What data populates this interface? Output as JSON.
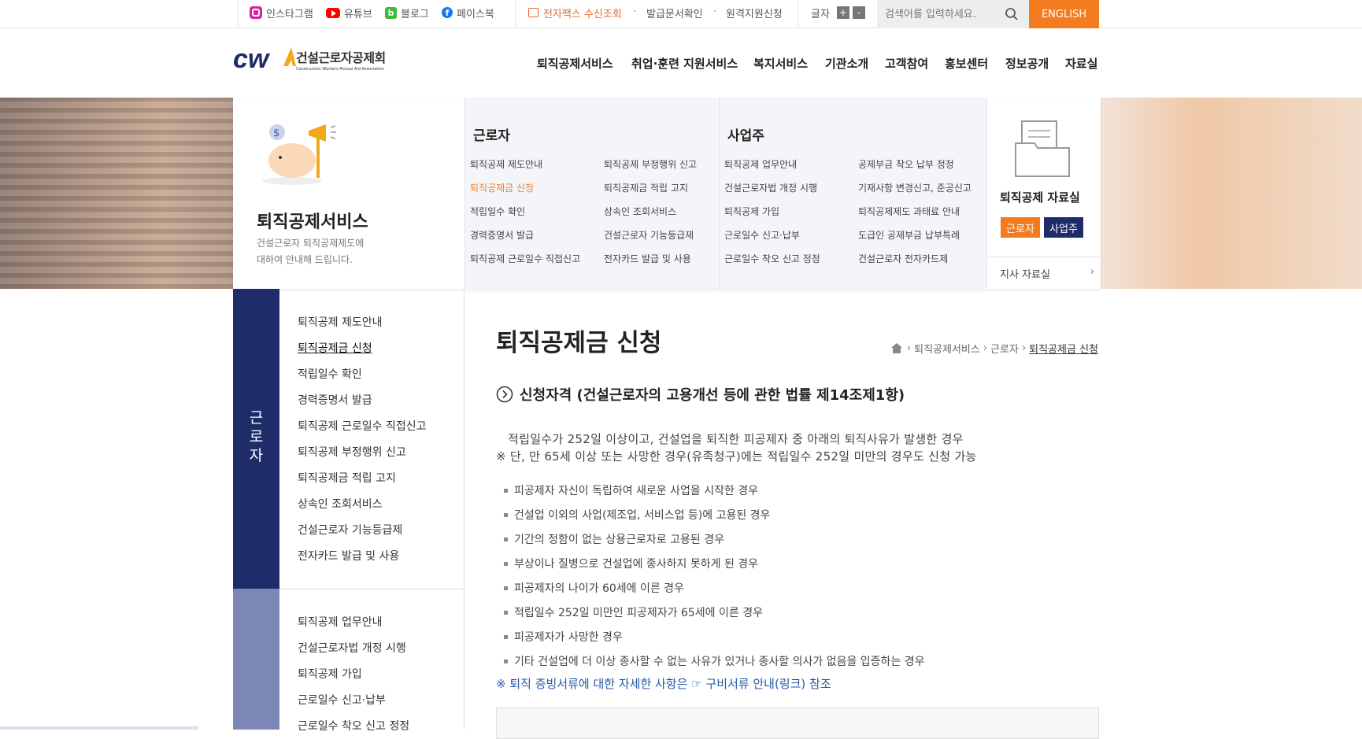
{
  "topbar": {
    "sns": [
      {
        "label": "인스타그램",
        "icon": "instagram-icon",
        "color": "#d6249f"
      },
      {
        "label": "유튜브",
        "icon": "youtube-icon",
        "color": "#ff0000"
      },
      {
        "label": "블로그",
        "icon": "blog-icon",
        "color": "#3dbb36"
      },
      {
        "label": "페이스북",
        "icon": "facebook-icon",
        "color": "#1877f2"
      }
    ],
    "fax_link": "전자팩스 수신조회",
    "doc_link": "발급문서확인",
    "remote_link": "원격지원신청",
    "font_size_label": "글자",
    "font_plus": "+",
    "font_minus": "-",
    "search_placeholder": "검색어를 입력하세요.",
    "english": "ENGLISH"
  },
  "header": {
    "logo_mark": "cw",
    "logo_kr": "건설근로자공제회",
    "logo_en": "Construction Workers Mutual Aid Association",
    "gnb": [
      "퇴직공제서비스",
      "취업·훈련 지원서비스",
      "복지서비스",
      "기관소개",
      "고객참여",
      "홍보센터",
      "정보공개",
      "자료실"
    ]
  },
  "mega": {
    "intro_title": "퇴직공제서비스",
    "intro_desc_1": "건설근로자 퇴직공제제도에",
    "intro_desc_2": "대하여 안내해 드립니다.",
    "worker_title": "근로자",
    "worker_col1": [
      "퇴직공제 제도안내",
      "퇴직공제금 신청",
      "적립일수 확인",
      "경력증명서 발급",
      "퇴직공제 근로일수 직접신고"
    ],
    "worker_col2": [
      "퇴직공제 부정행위 신고",
      "퇴직공제금 적립 고지",
      "상속인 조회서비스",
      "건설근로자 기능등급제",
      "전자카드 발급 및 사용"
    ],
    "employer_title": "사업주",
    "employer_col1": [
      "퇴직공제 업무안내",
      "건설근로자법 개정 시행",
      "퇴직공제 가입",
      "근로일수 신고·납부",
      "근로일수 착오 신고 정정"
    ],
    "employer_col2": [
      "공제부금 착오 납부 정정",
      "기재사항 변경신고, 준공신고",
      "퇴직공제제도 과태료 안내",
      "도급인 공제부금 납부특례",
      "건설근로자 전자카드제"
    ],
    "data_title": "퇴직공제 자료실",
    "data_worker_btn": "근로자",
    "data_employer_btn": "사업주",
    "branch_link": "지사 자료실",
    "accent": "#f47b20",
    "navy": "#1e2d6a"
  },
  "lnb": {
    "worker_label_chars": [
      "근",
      "로",
      "자"
    ],
    "worker_items": [
      "퇴직공제 제도안내",
      "퇴직공제금 신청",
      "적립일수 확인",
      "경력증명서 발급",
      "퇴직공제 근로일수 직접신고",
      "퇴직공제 부정행위 신고",
      "퇴직공제금 적립 고지",
      "상속인 조회서비스",
      "건설근로자 기능등급제",
      "전자카드 발급 및 사용"
    ],
    "employer_items": [
      "퇴직공제 업무안내",
      "건설근로자법 개정 시행",
      "퇴직공제 가입",
      "근로일수 신고·납부",
      "근로일수 착오 신고 정정"
    ]
  },
  "content": {
    "title": "퇴직공제금 신청",
    "breadcrumb": [
      "퇴직공제서비스",
      "근로자",
      "퇴직공제금 신청"
    ],
    "section_title": "신청자격 (건설근로자의 고용개선 등에 관한 법률 제14조제1항)",
    "lead_1": "적립일수가 252일 이상이고, 건설업을 퇴직한 피공제자 중 아래의 퇴직사유가 발생한 경우",
    "lead_2": "※ 단, 만 65세 이상 또는 사망한 경우(유족청구)에는 적립일수 252일 미만의 경우도 신청 가능",
    "bullets": [
      "피공제자 자신이 독립하여 새로운 사업을 시작한 경우",
      "건설업 이외의 사업(제조업, 서비스업 등)에 고용된 경우",
      "기간의 정함이 없는 상용근로자로 고용된 경우",
      "부상이나 질병으로 건설업에 종사하지 못하게 된 경우",
      "피공제자의 나이가 60세에 이른 경우",
      "적립일수 252일 미만인 피공제자가 65세에 이른 경우",
      "피공제자가 사망한 경우",
      "기타 건설업에 더 이상 종사할 수 없는 사유가 있거나 종사할 의사가 없음을 입증하는 경우"
    ],
    "note": "※ 퇴직 증빙서류에 대한 자세한 사항은 ☞ 구비서류 안내(링크) 참조",
    "link_color": "#2458a8"
  }
}
